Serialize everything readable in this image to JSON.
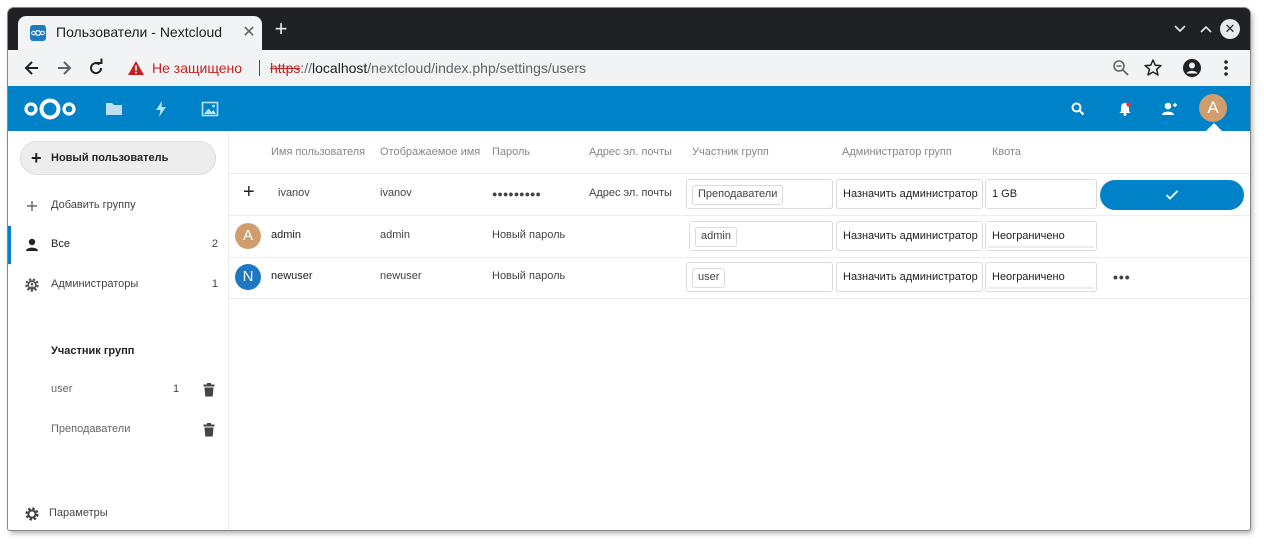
{
  "browser": {
    "tab_title": "Пользователи - Nextcloud",
    "tab_close": "✕",
    "new_tab": "+",
    "insecure_label": "Не защищено",
    "url_scheme": "https",
    "url_sep": "://",
    "url_host": "localhost",
    "url_path": "/nextcloud/index.php/settings/users"
  },
  "header": {
    "avatar_letter": "A",
    "avatar_color": "#d09e6d",
    "brand_color": "#0082c9"
  },
  "sidebar": {
    "new_user": "Новый пользователь",
    "add_group": "Добавить группу",
    "all_label": "Все",
    "all_count": "2",
    "admins_label": "Администраторы",
    "admins_count": "1",
    "groups_caption": "Участник групп",
    "groups": [
      {
        "name": "user",
        "count": "1"
      },
      {
        "name": "Преподаватели",
        "count": ""
      }
    ],
    "settings": "Параметры"
  },
  "table": {
    "columns": {
      "username": "Имя пользователя",
      "display_name": "Отображаемое имя",
      "password": "Пароль",
      "email": "Адрес эл. почты",
      "groups": "Участник групп",
      "subadmin": "Администратор групп",
      "quota": "Квота"
    },
    "new_row": {
      "plus": "+",
      "username": "ivanov",
      "display_name": "ivanov",
      "password": "●●●●●●●●●",
      "email": "Адрес эл. почты",
      "group_chip": "Преподаватели",
      "subadmin": "Назначить администратор",
      "quota": "1 GB"
    },
    "rows": [
      {
        "avatar_letter": "A",
        "avatar_color": "#d09e6d",
        "username": "admin",
        "display_name": "admin",
        "password": "Новый пароль",
        "group_chip": "admin",
        "subadmin": "Назначить администратор",
        "quota": "Неограничено"
      },
      {
        "avatar_letter": "N",
        "avatar_color": "#1e78c1",
        "username": "newuser",
        "display_name": "newuser",
        "password": "Новый пароль",
        "group_chip": "user",
        "subadmin": "Назначить администратор",
        "quota": "Неограничено",
        "more": "•••"
      }
    ]
  }
}
